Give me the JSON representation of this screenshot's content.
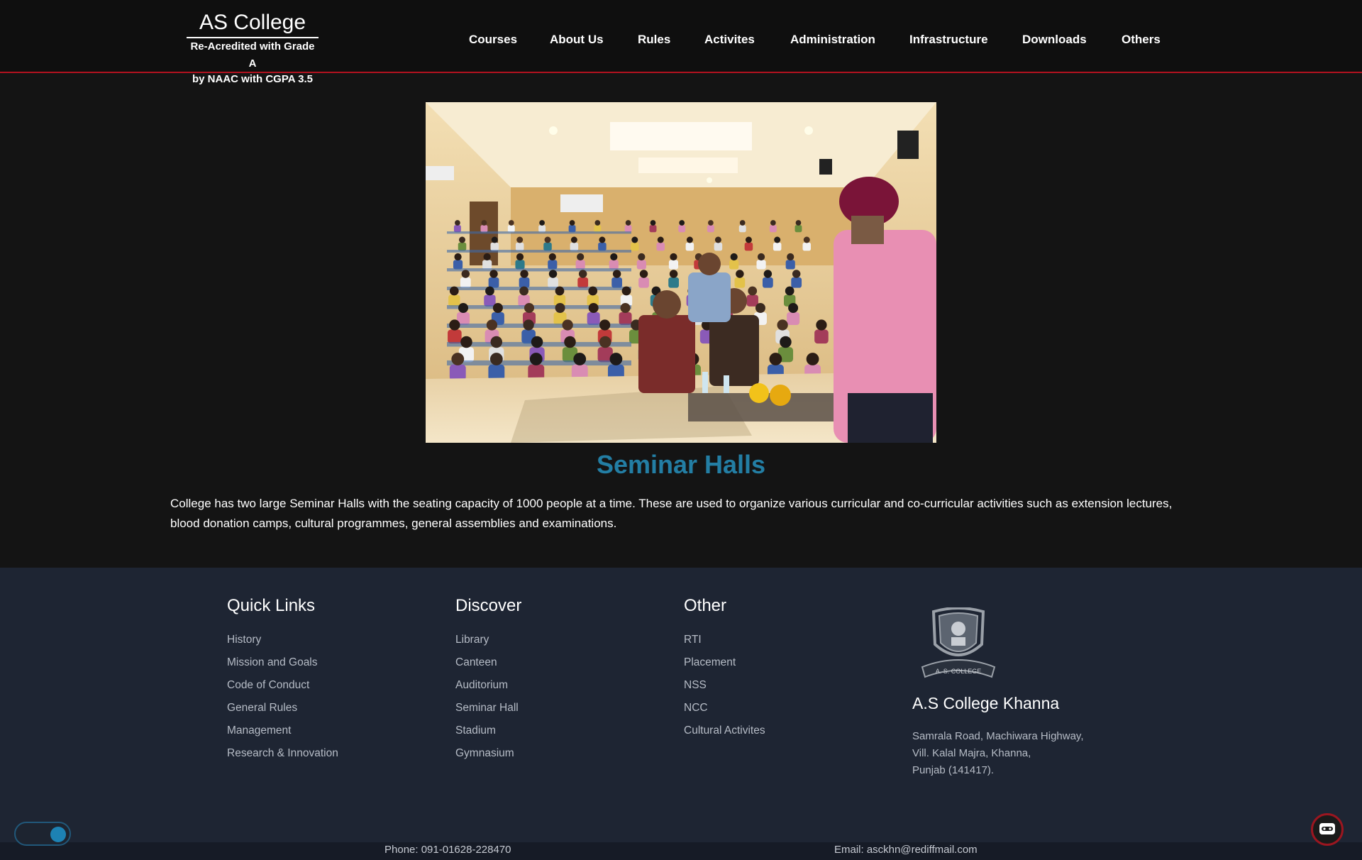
{
  "header": {
    "brand_title": "AS College",
    "brand_sub_line1": "Re-Acredited with Grade A",
    "brand_sub_line2": "by NAAC with CGPA 3.5",
    "nav": [
      "Courses",
      "About Us",
      "Rules",
      "Activites",
      "Administration",
      "Infrastructure",
      "Downloads",
      "Others"
    ]
  },
  "main": {
    "title": "Seminar Halls",
    "description": "College has two large Seminar Halls with the seating capacity of 1000 people at a time. These are used to organize various curricular and co-curricular activities such as extension lectures, blood donation camps, cultural programmes, general assemblies and examinations."
  },
  "footer": {
    "quick_links": {
      "title": "Quick Links",
      "items": [
        "History",
        "Mission and Goals",
        "Code of Conduct",
        "General Rules",
        "Management",
        "Research & Innovation"
      ]
    },
    "discover": {
      "title": "Discover",
      "items": [
        "Library",
        "Canteen",
        "Auditorium",
        "Seminar Hall",
        "Stadium",
        "Gymnasium"
      ]
    },
    "other": {
      "title": "Other",
      "items": [
        "RTI",
        "Placement",
        "NSS",
        "NCC",
        "Cultural Activites"
      ]
    },
    "college_name": "A.S College Khanna",
    "address_line1": "Samrala Road, Machiwara Highway,",
    "address_line2": "Vill. Kalal Majra, Khanna,",
    "address_line3": "Punjab (141417).",
    "logo_text": "A. S. COLLEGE",
    "phone": "Phone: 091-01628-228470",
    "email": "Email: asckhn@rediffmail.com"
  },
  "colors": {
    "accent": "#237ea4",
    "header_border": "#b3121f",
    "footer_bg": "#1e2533"
  },
  "icons": {
    "theme_toggle": "toggle-switch-icon",
    "chat": "chatbot-icon"
  }
}
